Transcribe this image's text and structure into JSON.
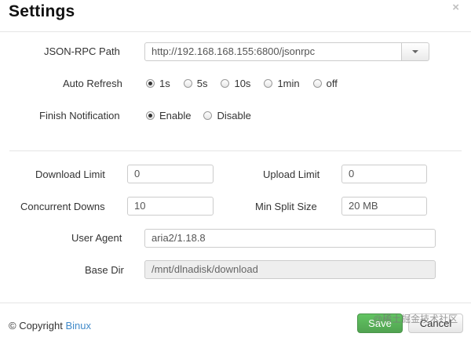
{
  "dialog": {
    "title": "Settings",
    "close_icon": "×"
  },
  "form": {
    "rpc_path": {
      "label": "JSON-RPC Path",
      "value": "http://192.168.168.155:6800/jsonrpc"
    },
    "auto_refresh": {
      "label": "Auto Refresh",
      "options": [
        "1s",
        "5s",
        "10s",
        "1min",
        "off"
      ],
      "selected": "1s"
    },
    "finish_notification": {
      "label": "Finish Notification",
      "options": [
        "Enable",
        "Disable"
      ],
      "selected": "Enable"
    },
    "download_limit": {
      "label": "Download Limit",
      "value": "0"
    },
    "upload_limit": {
      "label": "Upload Limit",
      "value": "0"
    },
    "concurrent_downloads": {
      "label": "Concurrent Downs",
      "value": "10"
    },
    "min_split_size": {
      "label": "Min Split Size",
      "value": "20 MB"
    },
    "user_agent": {
      "label": "User Agent",
      "value": "aria2/1.18.8"
    },
    "base_dir": {
      "label": "Base Dir",
      "value": "/mnt/dlnadisk/download"
    }
  },
  "footer": {
    "copyright_prefix": "© Copyright",
    "author": "Binux",
    "save_label": "Save",
    "cancel_label": "Cancel",
    "watermark": "@稀土掘金技术社区"
  },
  "colors": {
    "link": "#428bca",
    "save_button": "#5bb75b"
  }
}
